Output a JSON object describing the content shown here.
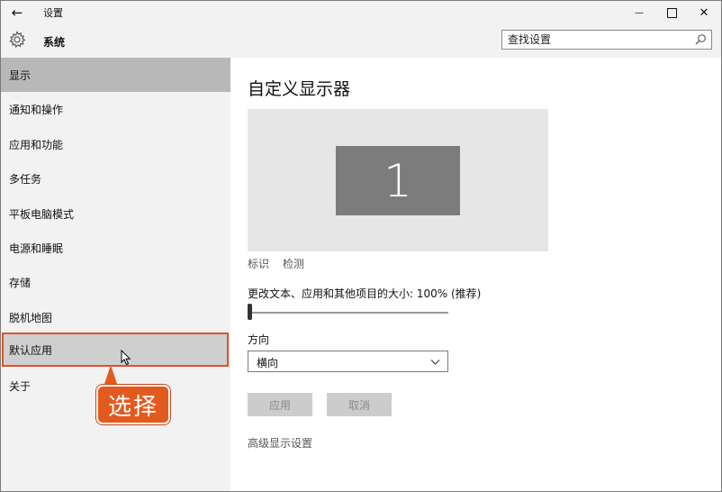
{
  "window": {
    "title": "设置",
    "back_glyph": "←",
    "minimize_glyph": "—",
    "close_glyph": "✕"
  },
  "header": {
    "title": "系统",
    "icon": "gear-icon"
  },
  "search": {
    "placeholder": "查找设置",
    "icon": "search-icon"
  },
  "sidebar": {
    "items": [
      {
        "label": "显示",
        "state": "selected"
      },
      {
        "label": "通知和操作",
        "state": "normal"
      },
      {
        "label": "应用和功能",
        "state": "normal"
      },
      {
        "label": "多任务",
        "state": "normal"
      },
      {
        "label": "平板电脑模式",
        "state": "normal"
      },
      {
        "label": "电源和睡眠",
        "state": "normal"
      },
      {
        "label": "存储",
        "state": "normal"
      },
      {
        "label": "脱机地图",
        "state": "normal"
      },
      {
        "label": "默认应用",
        "state": "hover-highlighted"
      },
      {
        "label": "关于",
        "state": "normal"
      }
    ]
  },
  "annotation": {
    "callout_text": "选择",
    "callout_color": "#e35a1f",
    "highlight_color": "#e0502a"
  },
  "main": {
    "title": "自定义显示器",
    "monitor_number": "1",
    "identify_link": "标识",
    "detect_link": "检测",
    "scale_label": "更改文本、应用和其他项目的大小: 100% (推荐)",
    "scale_slider_value": 0,
    "orientation_label": "方向",
    "orientation_value": "横向",
    "apply_button": "应用",
    "cancel_button": "取消",
    "advanced_link": "高级显示设置"
  },
  "colors": {
    "sidebar_bg": "#f2f2f2",
    "selected_bg": "#b8b8b8",
    "monitor_tile": "#7c7c7c",
    "display_area": "#e6e6e6",
    "disabled_button": "#cccccc"
  }
}
